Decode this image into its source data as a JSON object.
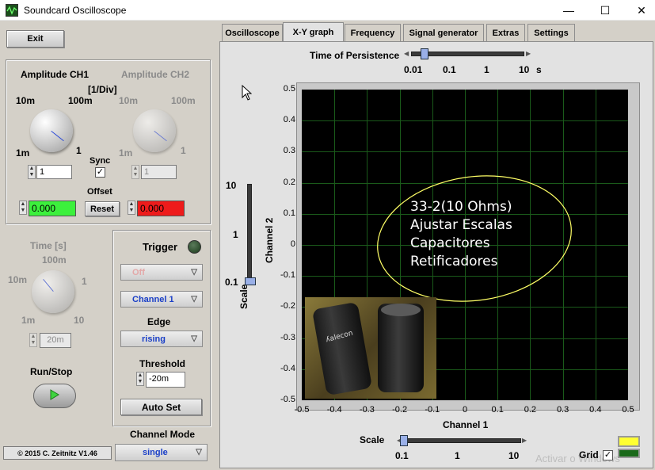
{
  "window": {
    "title": "Soundcard Oscilloscope",
    "minimize": "—",
    "maximize": "☐",
    "close": "✕"
  },
  "left": {
    "exit_label": "Exit",
    "amplitude_ch1": "Amplitude CH1",
    "amplitude_ch2": "Amplitude CH2",
    "per_div": "[1/Div]",
    "ch1_scale": {
      "top_left": "10m",
      "top_right": "100m",
      "bottom_left": "1m",
      "bottom_right": "1"
    },
    "ch2_scale": {
      "top_left": "10m",
      "top_right": "100m",
      "bottom_left": "1m",
      "bottom_right": "1"
    },
    "ch1_value": "1",
    "ch2_value": "1",
    "sync_label": "Sync",
    "offset_label": "Offset",
    "reset_label": "Reset",
    "offset_ch1": "0.000",
    "offset_ch2": "0.000",
    "time_label": "Time [s]",
    "time_scale": {
      "top": "100m",
      "left": "10m",
      "right": "1",
      "bottom_left": "1m",
      "bottom_right": "10"
    },
    "time_value": "20m",
    "run_stop_label": "Run/Stop",
    "copyright": "© 2015  C. Zeitnitz V1.46"
  },
  "trigger": {
    "title": "Trigger",
    "mode": "Off",
    "channel": "Channel 1",
    "edge_label": "Edge",
    "edge": "rising",
    "threshold_label": "Threshold",
    "threshold": "-20m",
    "autoset_label": "Auto Set",
    "channel_mode_label": "Channel Mode",
    "channel_mode": "single"
  },
  "tabs": [
    "Oscilloscope",
    "X-Y graph",
    "Frequency",
    "Signal generator",
    "Extras",
    "Settings"
  ],
  "active_tab": "X-Y graph",
  "persistence": {
    "label": "Time of Persistence",
    "ticks": [
      "0.01",
      "0.1",
      "1",
      "10"
    ],
    "unit": "s",
    "value": 0.02
  },
  "vscale": {
    "label": "Scale",
    "ticks": [
      "10",
      "1",
      "0.1"
    ],
    "value": 0.1
  },
  "graph": {
    "ylabel": "Channel 2",
    "xlabel": "Channel 1",
    "yticks": [
      "0.5",
      "0.4",
      "0.3",
      "0.2",
      "0.1",
      "0",
      "-0.1",
      "-0.2",
      "-0.3",
      "-0.4",
      "-0.5"
    ],
    "xticks": [
      "-0.5",
      "-0.4",
      "-0.3",
      "-0.2",
      "-0.1",
      "0",
      "0.1",
      "0.2",
      "0.3",
      "0.4",
      "0.5"
    ],
    "trace_color": "#ffff66",
    "grid_color": "#1a5a1a",
    "overlay_lines": [
      "33-2(10 Ohms)",
      "Ajustar Escalas",
      "Capacitores",
      "Retificadores"
    ]
  },
  "hscale": {
    "label": "Scale",
    "ticks": [
      "0.1",
      "1",
      "10"
    ],
    "value": 0.1
  },
  "grid_toggle": {
    "label": "Grid",
    "checked": true
  },
  "watermark": "Activar o Windows"
}
